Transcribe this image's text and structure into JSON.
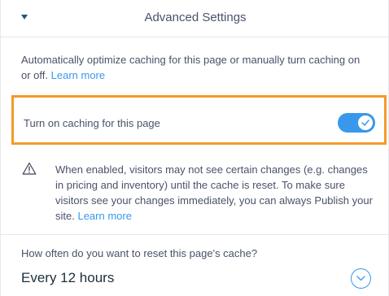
{
  "header": {
    "title": "Advanced Settings"
  },
  "description": {
    "text": "Automatically optimize caching for this page or manually turn caching on or off.",
    "link": "Learn more"
  },
  "caching_toggle": {
    "label": "Turn on caching for this page",
    "enabled": true
  },
  "warning": {
    "text": "When enabled, visitors may not see certain changes (e.g. changes in pricing and inventory) until the cache is reset. To make sure visitors see your changes immediately, you can always Publish your site.",
    "link": "Learn more"
  },
  "reset": {
    "label": "How often do you want to reset this page's cache?",
    "value": "Every 12 hours"
  },
  "colors": {
    "accent": "#3899ec",
    "highlight": "#f49a28",
    "text": "#4a5269"
  }
}
